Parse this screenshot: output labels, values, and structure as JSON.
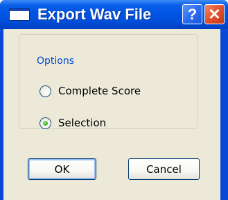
{
  "window": {
    "title": "Export Wav File",
    "help_label": "?",
    "close_label": "✕"
  },
  "options": {
    "group_label": "Options",
    "radios": [
      {
        "label": "Complete Score",
        "selected": false
      },
      {
        "label": "Selection",
        "selected": true
      }
    ]
  },
  "buttons": {
    "ok_label": "OK",
    "cancel_label": "Cancel"
  },
  "colors": {
    "titlebar": "#0054e3",
    "dialog_bg": "#ece9d8",
    "group_label": "#0046d5",
    "close_button": "#e2502a",
    "radio_dot": "#21a121"
  },
  "icons": [
    "app-window-icon",
    "help-icon",
    "close-icon",
    "radio-unchecked-icon",
    "radio-checked-icon"
  ]
}
